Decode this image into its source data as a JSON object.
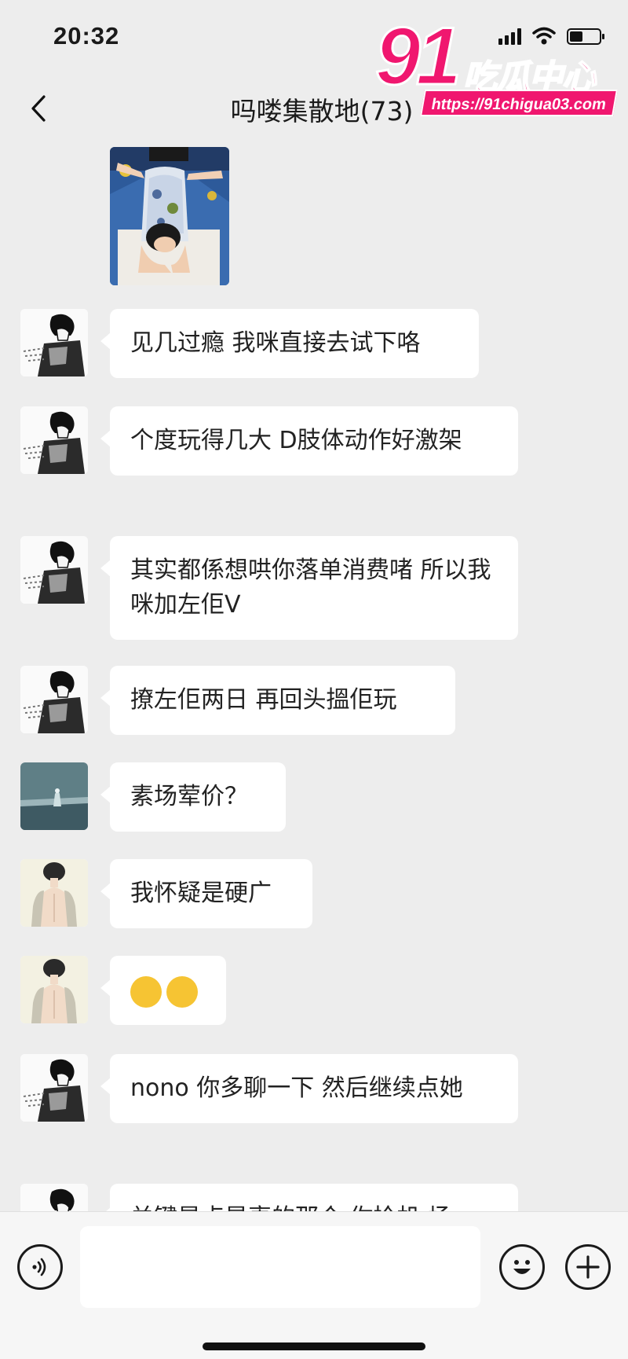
{
  "status_bar": {
    "time": "20:32",
    "signal_icon": "signal-bars-icon",
    "wifi_icon": "wifi-icon",
    "battery_icon": "battery-icon",
    "battery_level": 0.45
  },
  "header": {
    "back_icon": "chevron-left-icon",
    "title": "吗喽集散地(73)"
  },
  "watermark": {
    "big": "91",
    "brand": "吃瓜中心",
    "url": "https://91chigua03.com"
  },
  "messages": [
    {
      "type": "image",
      "sender": "unknown",
      "description_icon": "photo-image"
    },
    {
      "type": "text",
      "sender": "manga-boy",
      "text": "见几过瘾 我咪直接去试下咯"
    },
    {
      "type": "text",
      "sender": "manga-boy",
      "text": "个度玩得几大 D肢体动作好激架"
    },
    {
      "type": "text",
      "sender": "manga-boy",
      "text": "其实都係想哄你落单消费啫 所以我咪加左佢V"
    },
    {
      "type": "text",
      "sender": "manga-boy",
      "text": "撩左佢两日 再回头搵佢玩"
    },
    {
      "type": "text",
      "sender": "sea-scene",
      "text": "素场荤价？"
    },
    {
      "type": "text",
      "sender": "back-girl",
      "text": "我怀疑是硬广"
    },
    {
      "type": "emoji",
      "sender": "back-girl",
      "emoji": [
        "🤭",
        "🤭"
      ]
    },
    {
      "type": "text",
      "sender": "manga-boy",
      "text": "nono 你多聊一下 然后继续点她"
    },
    {
      "type": "text",
      "sender": "manga-boy",
      "text": "关键是点是衷的那个 你拎机 场"
    }
  ],
  "input_bar": {
    "voice_icon": "voice-wave-icon",
    "emoji_icon": "smiley-face-icon",
    "plus_icon": "plus-circle-icon",
    "placeholder": ""
  }
}
